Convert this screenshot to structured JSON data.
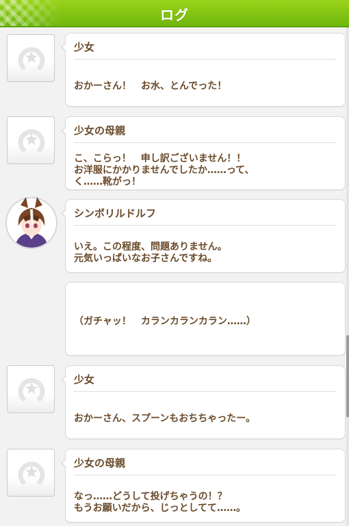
{
  "header": {
    "title": "ログ"
  },
  "entries": [
    {
      "speaker": "少女",
      "lines": [
        "おかーさん！　お水、とんでった！"
      ]
    },
    {
      "speaker": "少女の母親",
      "lines": [
        "こ、こらっ！　申し訳ございません！！",
        "お洋服にかかりませんでしたか……って、",
        "く……靴がっ！"
      ]
    },
    {
      "speaker": "シンボリルドルフ",
      "lines": [
        "いえ。この程度、問題ありません。",
        "元気いっぱいなお子さんですね。"
      ]
    },
    {
      "speaker": "",
      "lines": [
        "（ガチャッ！　カランカランカラン……）"
      ]
    },
    {
      "speaker": "少女",
      "lines": [
        "おかーさん、スプーンもおちちゃったー。"
      ]
    },
    {
      "speaker": "少女の母親",
      "lines": [
        "なっ……どうして投げちゃうの！？",
        "もうお願いだから、じっとしてて……。"
      ]
    }
  ],
  "colors": {
    "header": "#7cc514",
    "text": "#6a4a2a"
  },
  "icons": {
    "placeholder_avatar": "horseshoe-star-icon",
    "character_avatar": "horse-girl-portrait"
  }
}
